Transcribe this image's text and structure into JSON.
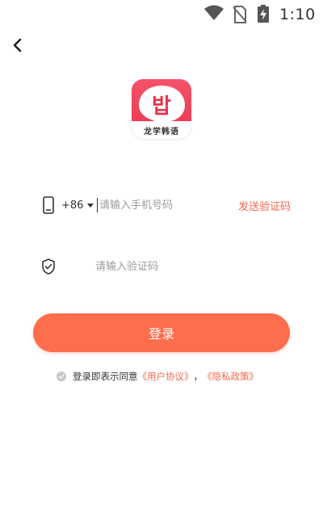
{
  "status_bar": {
    "time": "1:10",
    "icons": [
      "wifi-icon",
      "no-sim-icon",
      "battery-charging-icon"
    ]
  },
  "nav": {
    "back_icon": "chevron-left-icon"
  },
  "app": {
    "logo_glyph": "밥",
    "logo_caption": "龙学韩语"
  },
  "form": {
    "country_code": "+86",
    "phone_placeholder": "请输入手机号码",
    "send_code_label": "发送验证码",
    "code_placeholder": "请输入验证码"
  },
  "login_button": {
    "label": "登录"
  },
  "agreement": {
    "prefix": "登录即表示同意",
    "user_agreement": "《用户协议》",
    "separator": "，",
    "privacy_policy": "《隐私政策》"
  },
  "colors": {
    "accent": "#fe6d4c",
    "link": "#f1684c",
    "logo_red": "#e8354e",
    "text": "#333333",
    "placeholder": "#9b9b9b"
  }
}
